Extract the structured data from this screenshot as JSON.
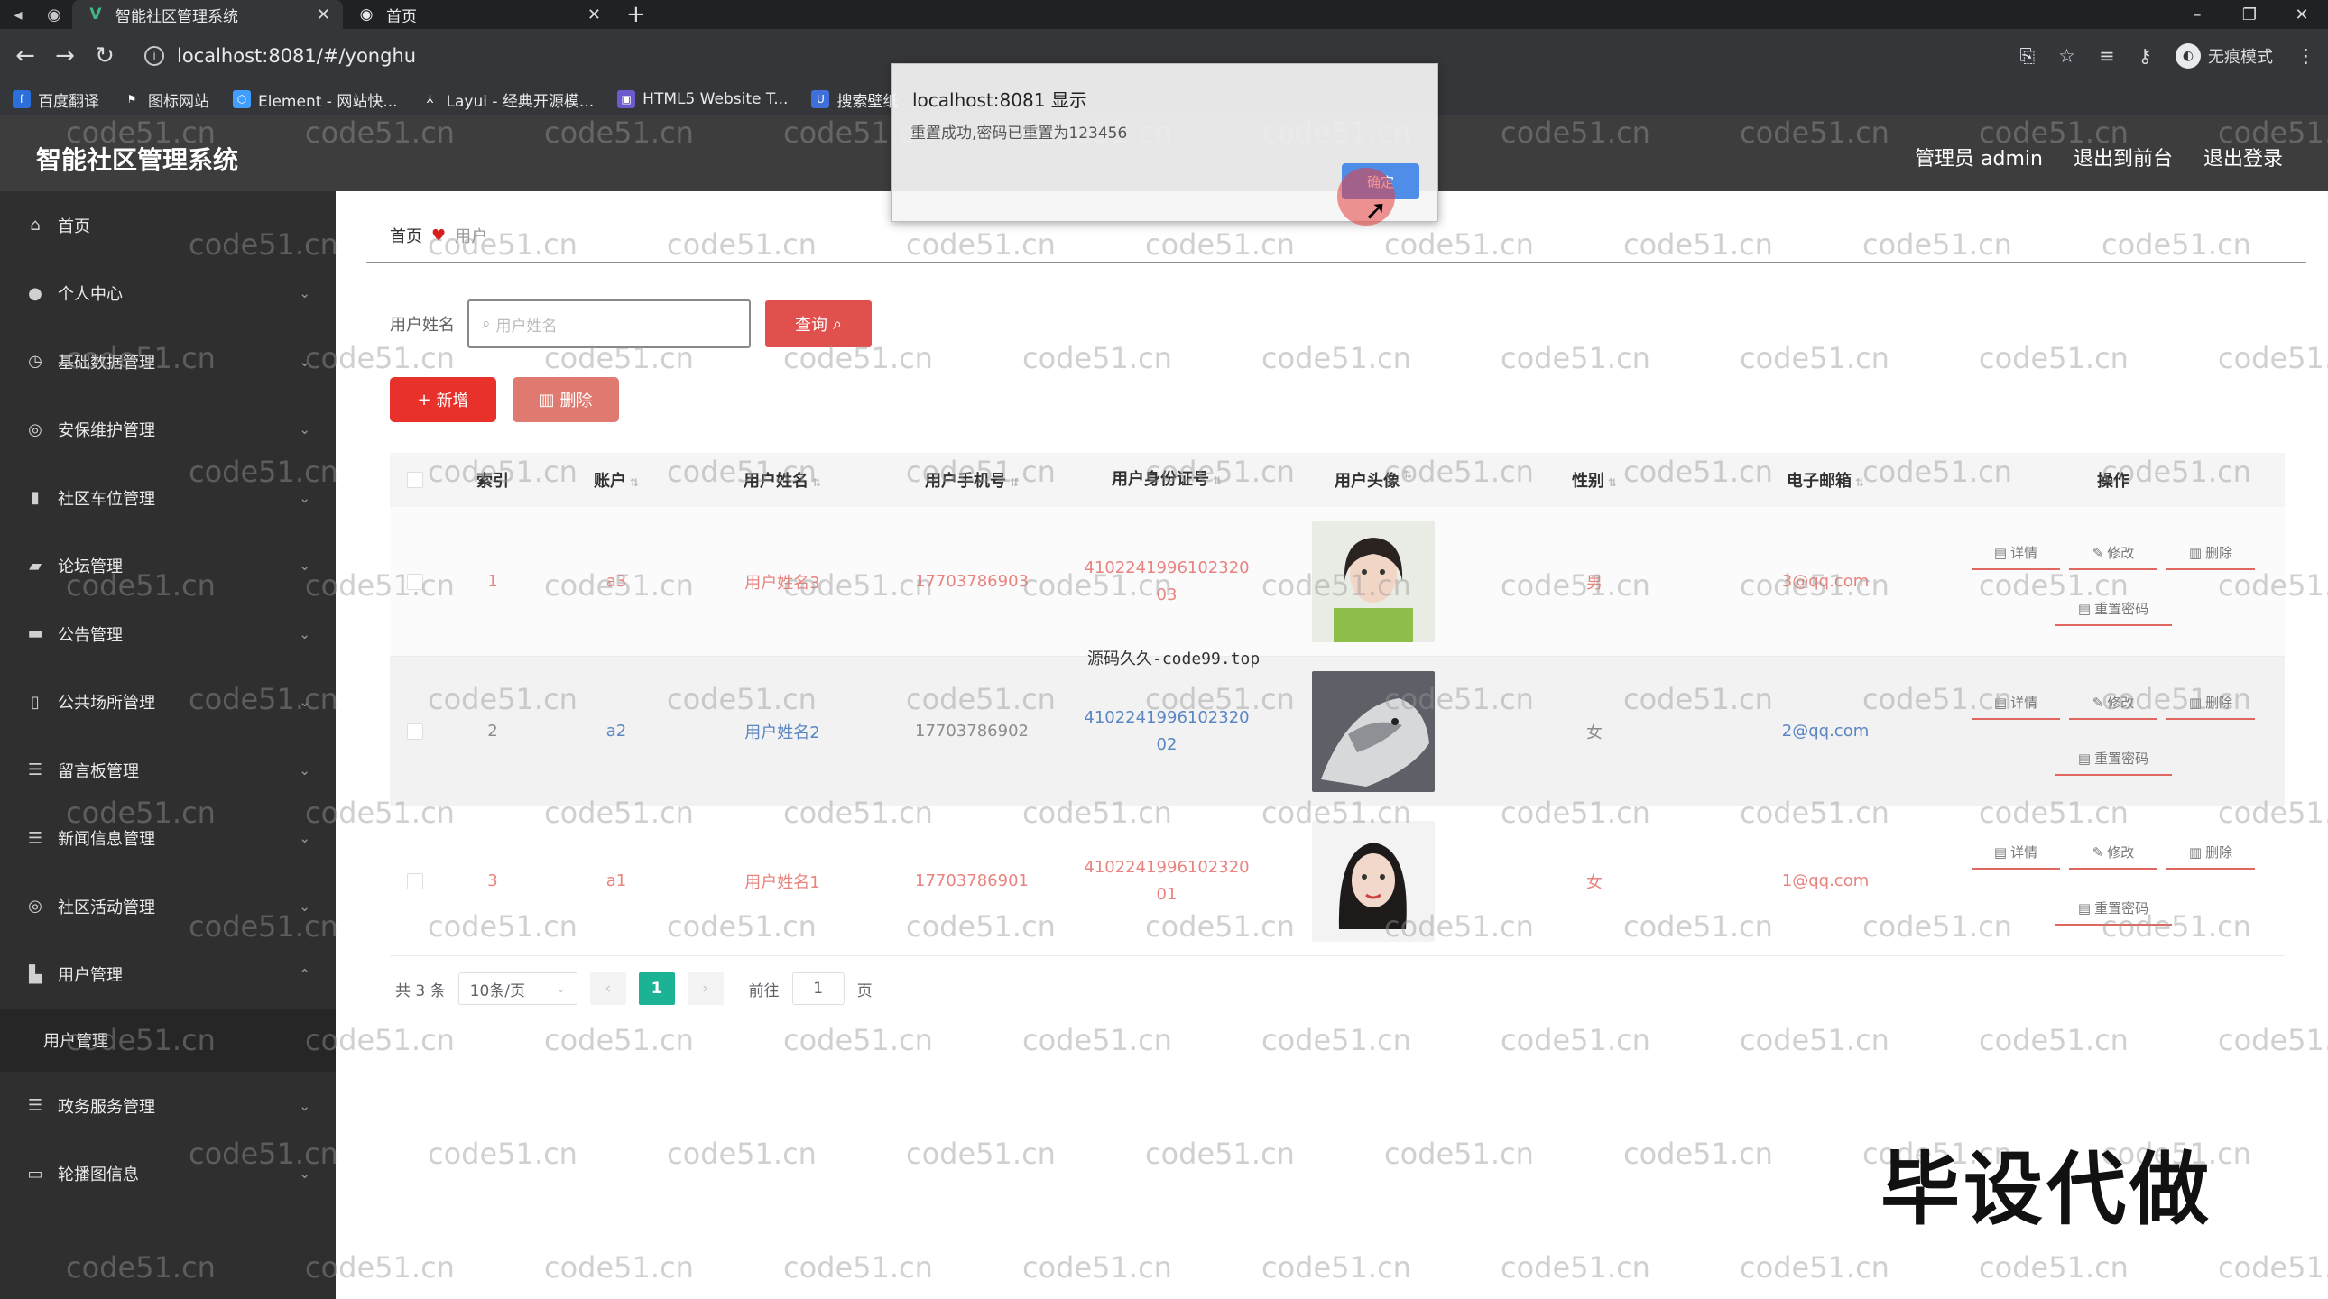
{
  "browser": {
    "tabs": [
      {
        "title": "智能社区管理系统",
        "active": true
      },
      {
        "title": "首页",
        "active": false
      }
    ],
    "url": "localhost:8081/#/yonghu",
    "profile_label": "无痕模式",
    "bookmarks": [
      {
        "label": "百度翻译",
        "icon": "translate-icon",
        "color": "#2a6fdb"
      },
      {
        "label": "图标网站",
        "icon": "flag-icon",
        "color": "#444"
      },
      {
        "label": "Element - 网站快...",
        "icon": "element-icon",
        "color": "#409eff"
      },
      {
        "label": "Layui - 经典开源模...",
        "icon": "layui-icon",
        "color": "#555"
      },
      {
        "label": "HTML5 Website T...",
        "icon": "html5-icon",
        "color": "#6a5acd"
      },
      {
        "label": "搜索壁纸",
        "icon": "u-icon",
        "color": "#3f6fd8"
      }
    ]
  },
  "header": {
    "title": "智能社区管理系统",
    "links": [
      "管理员 admin",
      "退出到前台",
      "退出登录"
    ]
  },
  "sidebar": {
    "items": [
      {
        "label": "首页",
        "icon": "home-icon",
        "glyph": "⌂",
        "expandable": false
      },
      {
        "label": "个人中心",
        "icon": "user-icon",
        "glyph": "●",
        "expandable": true
      },
      {
        "label": "基础数据管理",
        "icon": "clock-icon",
        "glyph": "◷",
        "expandable": true
      },
      {
        "label": "安保维护管理",
        "icon": "shield-icon",
        "glyph": "◎",
        "expandable": true
      },
      {
        "label": "社区车位管理",
        "icon": "chart-icon",
        "glyph": "▮",
        "expandable": true
      },
      {
        "label": "论坛管理",
        "icon": "forum-icon",
        "glyph": "▰",
        "expandable": true
      },
      {
        "label": "公告管理",
        "icon": "message-icon",
        "glyph": "▬",
        "expandable": true
      },
      {
        "label": "公共场所管理",
        "icon": "phone-icon",
        "glyph": "▯",
        "expandable": true
      },
      {
        "label": "留言板管理",
        "icon": "list-icon",
        "glyph": "☰",
        "expandable": true
      },
      {
        "label": "新闻信息管理",
        "icon": "menu-icon",
        "glyph": "☰",
        "expandable": true
      },
      {
        "label": "社区活动管理",
        "icon": "compass-icon",
        "glyph": "◎",
        "expandable": true
      },
      {
        "label": "用户管理",
        "icon": "folder-icon",
        "glyph": "▙",
        "expandable": true,
        "open": true
      }
    ],
    "open_sub": "用户管理",
    "items_after": [
      {
        "label": "政务服务管理",
        "icon": "menu-icon",
        "glyph": "☰"
      },
      {
        "label": "轮播图信息",
        "icon": "image-icon",
        "glyph": "▭"
      }
    ]
  },
  "breadcrumb": {
    "home": "首页",
    "current": "用户"
  },
  "search": {
    "label": "用户姓名",
    "placeholder": "用户姓名",
    "query_button": "查询"
  },
  "actions": {
    "add": "新增",
    "delete": "删除"
  },
  "table": {
    "columns": [
      "索引",
      "账户",
      "用户姓名",
      "用户手机号",
      "用户身份证号",
      "用户头像",
      "性别",
      "电子邮箱",
      "操作"
    ],
    "rows": [
      {
        "index": "1",
        "account": "a3",
        "name": "用户姓名3",
        "phone": "17703786903",
        "id_line1": "4102241996102320",
        "id_line2": "03",
        "sex": "男",
        "email": "3@qq.com"
      },
      {
        "index": "2",
        "account": "a2",
        "name": "用户姓名2",
        "phone": "17703786902",
        "id_line1": "4102241996102320",
        "id_line2": "02",
        "sex": "女",
        "email": "2@qq.com"
      },
      {
        "index": "3",
        "account": "a1",
        "name": "用户姓名1",
        "phone": "17703786901",
        "id_line1": "4102241996102320",
        "id_line2": "01",
        "sex": "女",
        "email": "1@qq.com"
      }
    ],
    "row_actions": {
      "detail": "详情",
      "edit": "修改",
      "delete": "删除",
      "reset": "重置密码"
    }
  },
  "pagination": {
    "total": "共 3 条",
    "page_size": "10条/页",
    "current": "1",
    "goto_prefix": "前往",
    "goto_value": "1",
    "goto_suffix": "页"
  },
  "dialog": {
    "title": "localhost:8081 显示",
    "message": "重置成功,密码已重置为123456",
    "ok": "确定"
  },
  "watermark": {
    "text": "code51.cn",
    "center_text": "源码久久-code99.top",
    "big_text": "毕设代做"
  },
  "colors": {
    "accent_red": "#e8312b",
    "pager_green": "#1bb394",
    "sidebar_bg": "#2f2f2f",
    "header_bg": "#3d3d3d"
  }
}
